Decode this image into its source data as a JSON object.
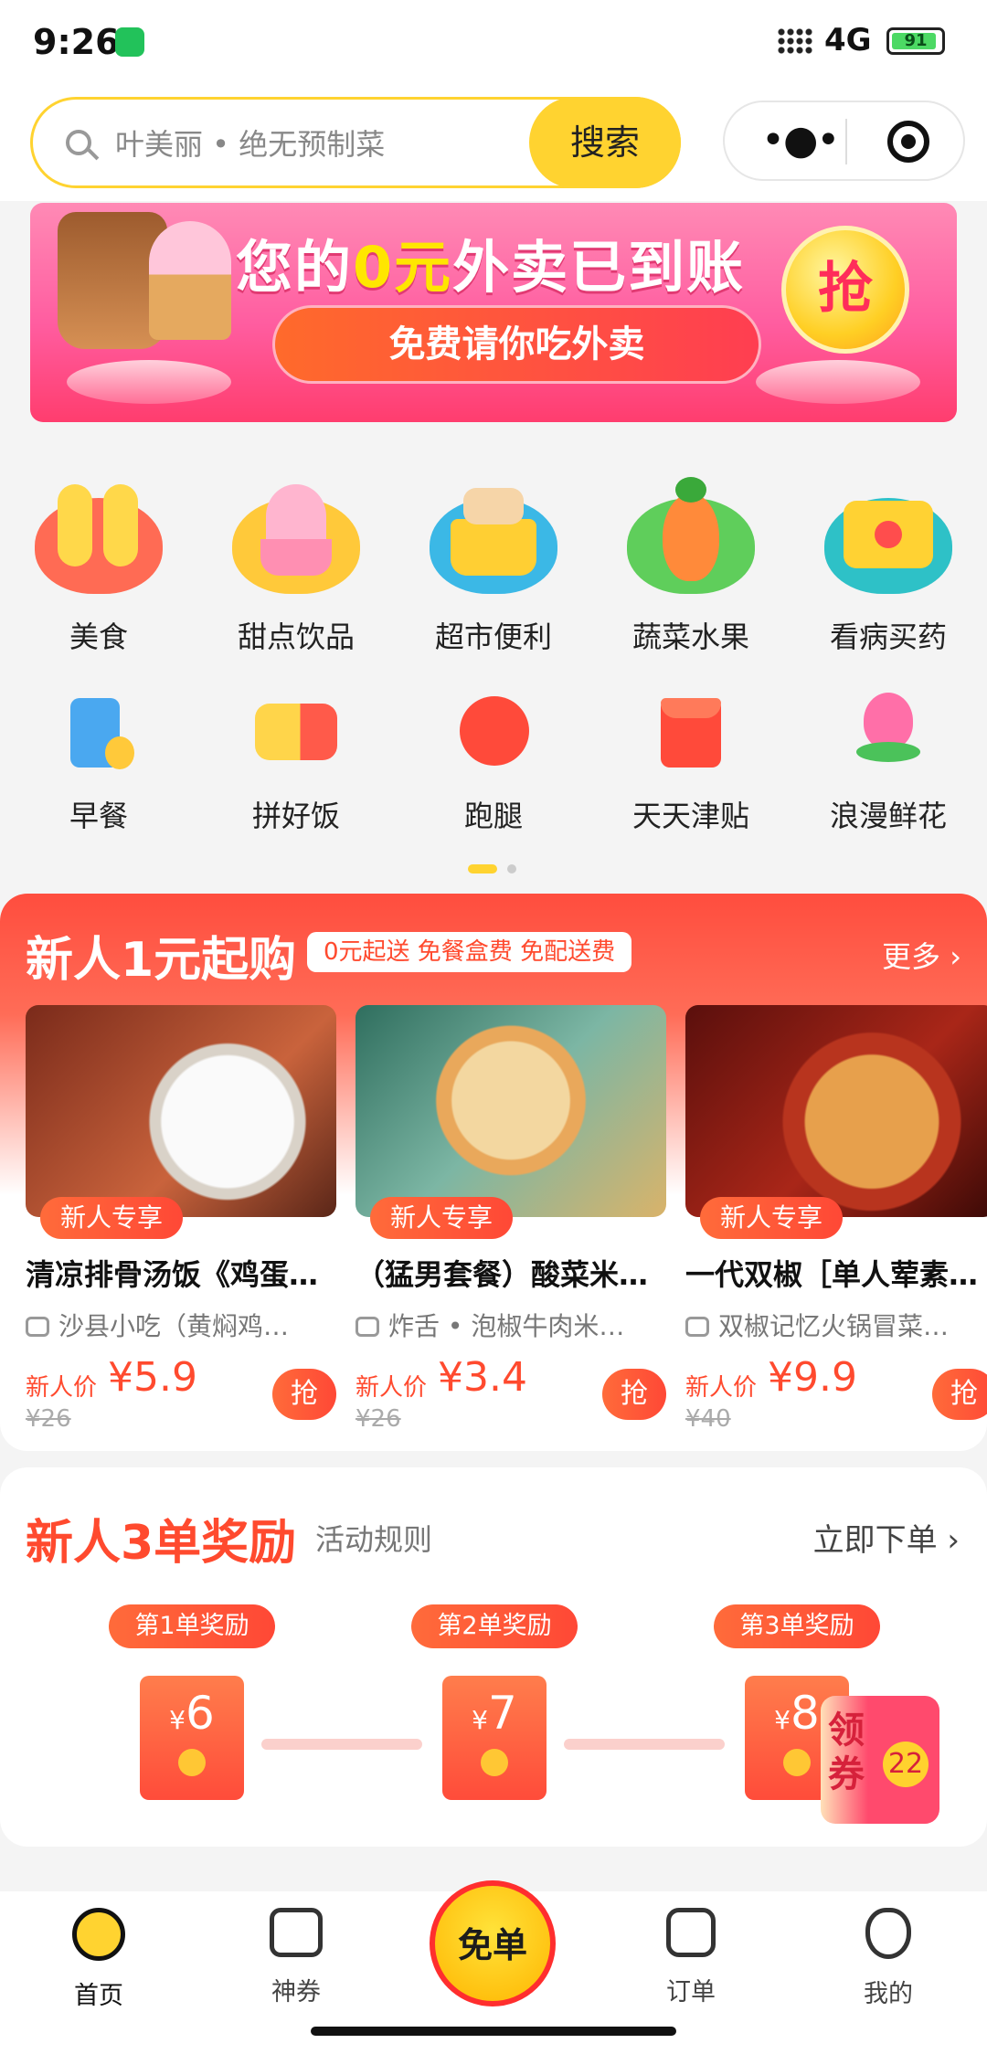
{
  "status_bar": {
    "time": "9:26",
    "network": "4G",
    "battery": "91"
  },
  "search": {
    "placeholder": "叶美丽 • 绝无预制菜",
    "button": "搜索"
  },
  "banner": {
    "title_pre": "您的",
    "title_hl": "0元",
    "title_post": "外卖已到账",
    "subtitle": "免费请你吃外卖",
    "grab": "抢"
  },
  "categories_row1": [
    {
      "label": "美食",
      "icon": "fork-spoon-icon"
    },
    {
      "label": "甜点饮品",
      "icon": "dessert-cup-icon"
    },
    {
      "label": "超市便利",
      "icon": "shopping-basket-icon"
    },
    {
      "label": "蔬菜水果",
      "icon": "vegetable-fruit-icon"
    },
    {
      "label": "看病买药",
      "icon": "medical-kit-icon"
    }
  ],
  "categories_row2": [
    {
      "label": "早餐",
      "icon": "milk-bottle-icon"
    },
    {
      "label": "拼好饭",
      "icon": "lunchbox-icon"
    },
    {
      "label": "跑腿",
      "icon": "runner-icon"
    },
    {
      "label": "天天津贴",
      "icon": "red-envelope-icon"
    },
    {
      "label": "浪漫鲜花",
      "icon": "flower-icon"
    }
  ],
  "new_user": {
    "title": "新人1元起购",
    "tag": "0元起送 免餐盒费 免配送费",
    "more": "更多",
    "badge": "新人专享",
    "price_label": "新人价",
    "grab": "抢",
    "items": [
      {
        "name": "清凉排骨汤饭《鸡蛋…",
        "shop": "沙县小吃（黄焖鸡…",
        "price": "¥5.9",
        "orig": "¥26"
      },
      {
        "name": "（猛男套餐）酸菜米…",
        "shop": "炸舌 • 泡椒牛肉米…",
        "price": "¥3.4",
        "orig": "¥26"
      },
      {
        "name": "一代双椒［单人荤素…",
        "shop": "双椒记忆火锅冒菜…",
        "price": "¥9.9",
        "orig": "¥40"
      }
    ]
  },
  "rewards": {
    "title": "新人3单奖励",
    "rule": "活动规则",
    "action": "立即下单",
    "steps": [
      {
        "label": "第1单奖励",
        "amount": "6"
      },
      {
        "label": "第2单奖励",
        "amount": "7"
      },
      {
        "label": "第3单奖励",
        "amount": "8"
      }
    ],
    "currency": "¥",
    "coupon_word": "领券",
    "coupon_count": "22"
  },
  "tabbar": {
    "tabs": [
      {
        "label": "首页",
        "icon": "home-icon"
      },
      {
        "label": "神券",
        "icon": "coupon-icon"
      },
      {
        "label": "订单",
        "icon": "order-icon"
      },
      {
        "label": "我的",
        "icon": "profile-icon"
      }
    ],
    "center": "免单"
  },
  "colors": {
    "brand_yellow": "#ffd330",
    "accent_red": "#ff4a2e"
  }
}
